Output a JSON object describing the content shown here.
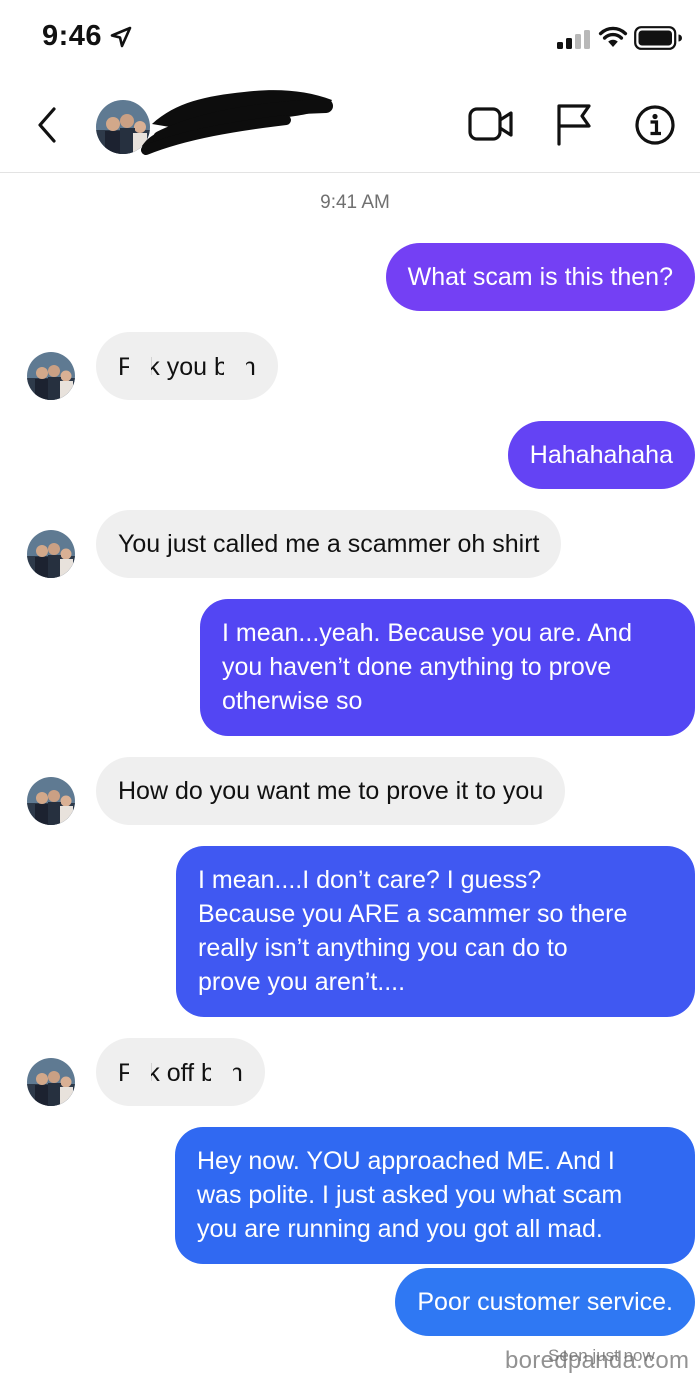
{
  "status_bar": {
    "time": "9:46"
  },
  "chat": {
    "timestamp": "9:41 AM",
    "seen_label": "Seen just now",
    "messages": [
      {
        "side": "out",
        "text": "What scam is this then?"
      },
      {
        "side": "in",
        "parts": [
          "F",
          "k you b",
          "h"
        ]
      },
      {
        "side": "out",
        "text": "Hahahahaha"
      },
      {
        "side": "in",
        "text": "You just called me a scammer oh shirt"
      },
      {
        "side": "out",
        "lines": [
          "I mean...yeah. Because you are. And",
          "you haven’t done anything to prove",
          "otherwise so"
        ]
      },
      {
        "side": "in",
        "text": "How do you want me to prove it to you"
      },
      {
        "side": "out",
        "lines": [
          "I mean....I don’t care? I guess?",
          "Because you ARE a scammer so there",
          "really isn’t anything you can do to",
          "prove you aren’t...."
        ]
      },
      {
        "side": "in",
        "parts": [
          "F",
          "k off b",
          "h"
        ]
      },
      {
        "side": "out",
        "lines": [
          "Hey now. YOU approached ME. And I",
          "was polite. I just asked you what scam",
          "you are running and you got all mad."
        ]
      },
      {
        "side": "out",
        "text": "Poor customer service."
      }
    ]
  },
  "watermark": "boredpanda.com",
  "colors": {
    "gradient_top": "#7a3ff5",
    "gradient_mid": "#4f4ff2",
    "gradient_bottom": "#2f7cf6",
    "incoming_bg": "#efefef"
  },
  "icons": [
    "location-arrow-icon",
    "signal-icon",
    "wifi-icon",
    "battery-icon",
    "back-chevron-icon",
    "video-call-icon",
    "flag-icon",
    "info-icon"
  ]
}
